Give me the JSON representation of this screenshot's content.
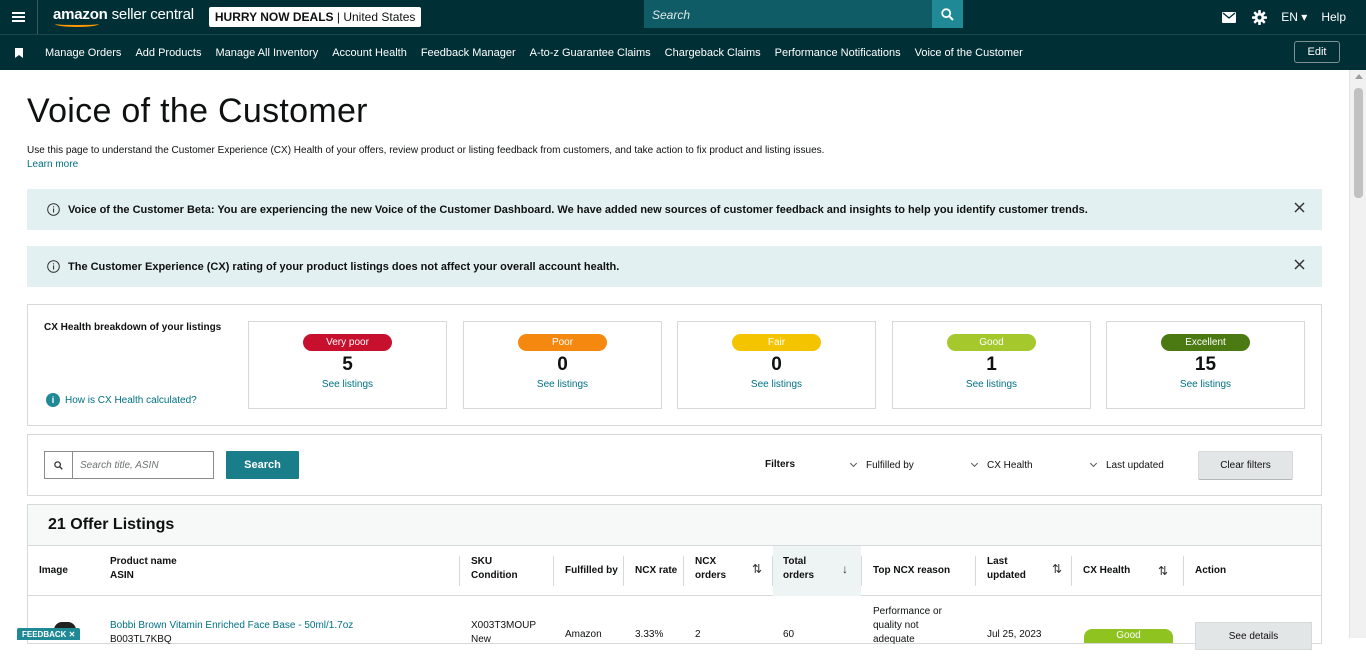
{
  "topbar": {
    "logo_text_1": "amazon",
    "logo_text_2": " seller central",
    "store_name": "HURRY NOW DEALS",
    "store_sep": " | ",
    "store_country": "United States",
    "search_placeholder": "Search",
    "language": "EN",
    "help": "Help"
  },
  "nav": {
    "items": [
      "Manage Orders",
      "Add Products",
      "Manage All Inventory",
      "Account Health",
      "Feedback Manager",
      "A-to-z Guarantee Claims",
      "Chargeback Claims",
      "Performance Notifications",
      "Voice of the Customer"
    ],
    "edit": "Edit"
  },
  "page": {
    "title": "Voice of the Customer",
    "intro": "Use this page to understand the Customer Experience (CX) Health of your offers, review product or listing feedback from customers, and take action to fix product and listing issues.",
    "learn_more": "Learn more"
  },
  "alerts": [
    "Voice of the Customer Beta: You are experiencing the new Voice of the Customer Dashboard. We have added new sources of customer feedback and insights to help you identify customer trends.",
    "The Customer Experience (CX) rating of your product listings does not affect your overall account health."
  ],
  "cx": {
    "title": "CX Health breakdown of your listings",
    "help_link": "How is CX Health calculated?",
    "tiles": [
      {
        "label": "Very poor",
        "count": "5",
        "link": "See listings",
        "color": "#c7102e"
      },
      {
        "label": "Poor",
        "count": "0",
        "link": "See listings",
        "color": "#f5880f"
      },
      {
        "label": "Fair",
        "count": "0",
        "link": "See listings",
        "color": "#f5c400"
      },
      {
        "label": "Good",
        "count": "1",
        "link": "See listings",
        "color": "#a5c92d"
      },
      {
        "label": "Excellent",
        "count": "15",
        "link": "See listings",
        "color": "#4c7a12"
      }
    ]
  },
  "filters": {
    "search_placeholder": "Search title, ASIN",
    "search_button": "Search",
    "label": "Filters",
    "fulfilled_by": "Fulfilled by",
    "cx_health": "CX Health",
    "last_updated": "Last updated",
    "clear": "Clear filters"
  },
  "table": {
    "title": "21 Offer Listings",
    "columns": {
      "image": "Image",
      "product_name": "Product name",
      "asin": "ASIN",
      "sku": "SKU",
      "condition": "Condition",
      "fulfilled_by": "Fulfilled by",
      "ncx_rate": "NCX rate",
      "ncx_orders_1": "NCX",
      "ncx_orders_2": "orders",
      "total_orders_1": "Total",
      "total_orders_2": "orders",
      "top_reason": "Top NCX reason",
      "last_updated_1": "Last",
      "last_updated_2": "updated",
      "cx_health": "CX Health",
      "action": "Action"
    },
    "rows": [
      {
        "product": "Bobbi Brown Vitamin Enriched Face Base - 50ml/1.7oz",
        "asin": "B003TL7KBQ",
        "sku": "X003T3MOUP",
        "condition": "New",
        "fulfilled_by": "Amazon",
        "ncx_rate": "3.33%",
        "ncx_orders": "2",
        "total_orders": "60",
        "reason_1": "Performance or",
        "reason_2": "quality not",
        "reason_3": "adequate",
        "last_updated": "Jul 25, 2023",
        "cx_health": "Good",
        "action": "See details"
      }
    ]
  },
  "feedback_tab": "FEEDBACK ✕"
}
